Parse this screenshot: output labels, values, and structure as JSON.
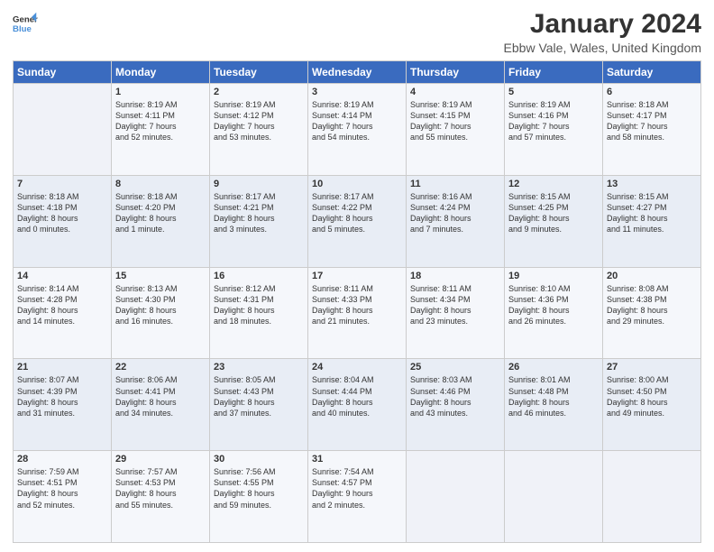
{
  "header": {
    "logo_line1": "General",
    "logo_line2": "Blue",
    "title": "January 2024",
    "subtitle": "Ebbw Vale, Wales, United Kingdom"
  },
  "days_of_week": [
    "Sunday",
    "Monday",
    "Tuesday",
    "Wednesday",
    "Thursday",
    "Friday",
    "Saturday"
  ],
  "weeks": [
    [
      {
        "day": "",
        "text": ""
      },
      {
        "day": "1",
        "text": "Sunrise: 8:19 AM\nSunset: 4:11 PM\nDaylight: 7 hours\nand 52 minutes."
      },
      {
        "day": "2",
        "text": "Sunrise: 8:19 AM\nSunset: 4:12 PM\nDaylight: 7 hours\nand 53 minutes."
      },
      {
        "day": "3",
        "text": "Sunrise: 8:19 AM\nSunset: 4:14 PM\nDaylight: 7 hours\nand 54 minutes."
      },
      {
        "day": "4",
        "text": "Sunrise: 8:19 AM\nSunset: 4:15 PM\nDaylight: 7 hours\nand 55 minutes."
      },
      {
        "day": "5",
        "text": "Sunrise: 8:19 AM\nSunset: 4:16 PM\nDaylight: 7 hours\nand 57 minutes."
      },
      {
        "day": "6",
        "text": "Sunrise: 8:18 AM\nSunset: 4:17 PM\nDaylight: 7 hours\nand 58 minutes."
      }
    ],
    [
      {
        "day": "7",
        "text": "Sunrise: 8:18 AM\nSunset: 4:18 PM\nDaylight: 8 hours\nand 0 minutes."
      },
      {
        "day": "8",
        "text": "Sunrise: 8:18 AM\nSunset: 4:20 PM\nDaylight: 8 hours\nand 1 minute."
      },
      {
        "day": "9",
        "text": "Sunrise: 8:17 AM\nSunset: 4:21 PM\nDaylight: 8 hours\nand 3 minutes."
      },
      {
        "day": "10",
        "text": "Sunrise: 8:17 AM\nSunset: 4:22 PM\nDaylight: 8 hours\nand 5 minutes."
      },
      {
        "day": "11",
        "text": "Sunrise: 8:16 AM\nSunset: 4:24 PM\nDaylight: 8 hours\nand 7 minutes."
      },
      {
        "day": "12",
        "text": "Sunrise: 8:15 AM\nSunset: 4:25 PM\nDaylight: 8 hours\nand 9 minutes."
      },
      {
        "day": "13",
        "text": "Sunrise: 8:15 AM\nSunset: 4:27 PM\nDaylight: 8 hours\nand 11 minutes."
      }
    ],
    [
      {
        "day": "14",
        "text": "Sunrise: 8:14 AM\nSunset: 4:28 PM\nDaylight: 8 hours\nand 14 minutes."
      },
      {
        "day": "15",
        "text": "Sunrise: 8:13 AM\nSunset: 4:30 PM\nDaylight: 8 hours\nand 16 minutes."
      },
      {
        "day": "16",
        "text": "Sunrise: 8:12 AM\nSunset: 4:31 PM\nDaylight: 8 hours\nand 18 minutes."
      },
      {
        "day": "17",
        "text": "Sunrise: 8:11 AM\nSunset: 4:33 PM\nDaylight: 8 hours\nand 21 minutes."
      },
      {
        "day": "18",
        "text": "Sunrise: 8:11 AM\nSunset: 4:34 PM\nDaylight: 8 hours\nand 23 minutes."
      },
      {
        "day": "19",
        "text": "Sunrise: 8:10 AM\nSunset: 4:36 PM\nDaylight: 8 hours\nand 26 minutes."
      },
      {
        "day": "20",
        "text": "Sunrise: 8:08 AM\nSunset: 4:38 PM\nDaylight: 8 hours\nand 29 minutes."
      }
    ],
    [
      {
        "day": "21",
        "text": "Sunrise: 8:07 AM\nSunset: 4:39 PM\nDaylight: 8 hours\nand 31 minutes."
      },
      {
        "day": "22",
        "text": "Sunrise: 8:06 AM\nSunset: 4:41 PM\nDaylight: 8 hours\nand 34 minutes."
      },
      {
        "day": "23",
        "text": "Sunrise: 8:05 AM\nSunset: 4:43 PM\nDaylight: 8 hours\nand 37 minutes."
      },
      {
        "day": "24",
        "text": "Sunrise: 8:04 AM\nSunset: 4:44 PM\nDaylight: 8 hours\nand 40 minutes."
      },
      {
        "day": "25",
        "text": "Sunrise: 8:03 AM\nSunset: 4:46 PM\nDaylight: 8 hours\nand 43 minutes."
      },
      {
        "day": "26",
        "text": "Sunrise: 8:01 AM\nSunset: 4:48 PM\nDaylight: 8 hours\nand 46 minutes."
      },
      {
        "day": "27",
        "text": "Sunrise: 8:00 AM\nSunset: 4:50 PM\nDaylight: 8 hours\nand 49 minutes."
      }
    ],
    [
      {
        "day": "28",
        "text": "Sunrise: 7:59 AM\nSunset: 4:51 PM\nDaylight: 8 hours\nand 52 minutes."
      },
      {
        "day": "29",
        "text": "Sunrise: 7:57 AM\nSunset: 4:53 PM\nDaylight: 8 hours\nand 55 minutes."
      },
      {
        "day": "30",
        "text": "Sunrise: 7:56 AM\nSunset: 4:55 PM\nDaylight: 8 hours\nand 59 minutes."
      },
      {
        "day": "31",
        "text": "Sunrise: 7:54 AM\nSunset: 4:57 PM\nDaylight: 9 hours\nand 2 minutes."
      },
      {
        "day": "",
        "text": ""
      },
      {
        "day": "",
        "text": ""
      },
      {
        "day": "",
        "text": ""
      }
    ]
  ]
}
